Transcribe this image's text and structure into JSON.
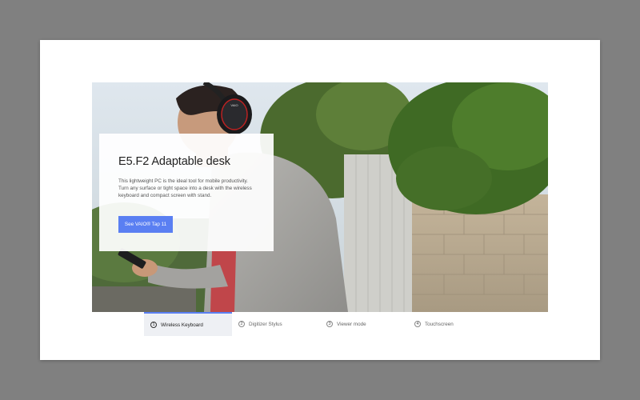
{
  "hero": {
    "title": "E5.F2 Adaptable desk",
    "description": "This lightweight PC is the ideal tool for mobile productivity. Turn any surface or tight space into a desk with the wireless keyboard and compact screen with stand.",
    "cta_label": "See VAIO® Tap 11",
    "headphone_brand": "VAIO"
  },
  "tabs": [
    {
      "num": "1",
      "label": "Wireless Keyboard",
      "active": true
    },
    {
      "num": "2",
      "label": "Digitizer Stylus",
      "active": false
    },
    {
      "num": "3",
      "label": "Viewer mode",
      "active": false
    },
    {
      "num": "4",
      "label": "Touchscreen",
      "active": false
    }
  ],
  "colors": {
    "accent": "#5a7ff2",
    "page_background": "#808080",
    "active_tab_background": "#eef0f4"
  }
}
